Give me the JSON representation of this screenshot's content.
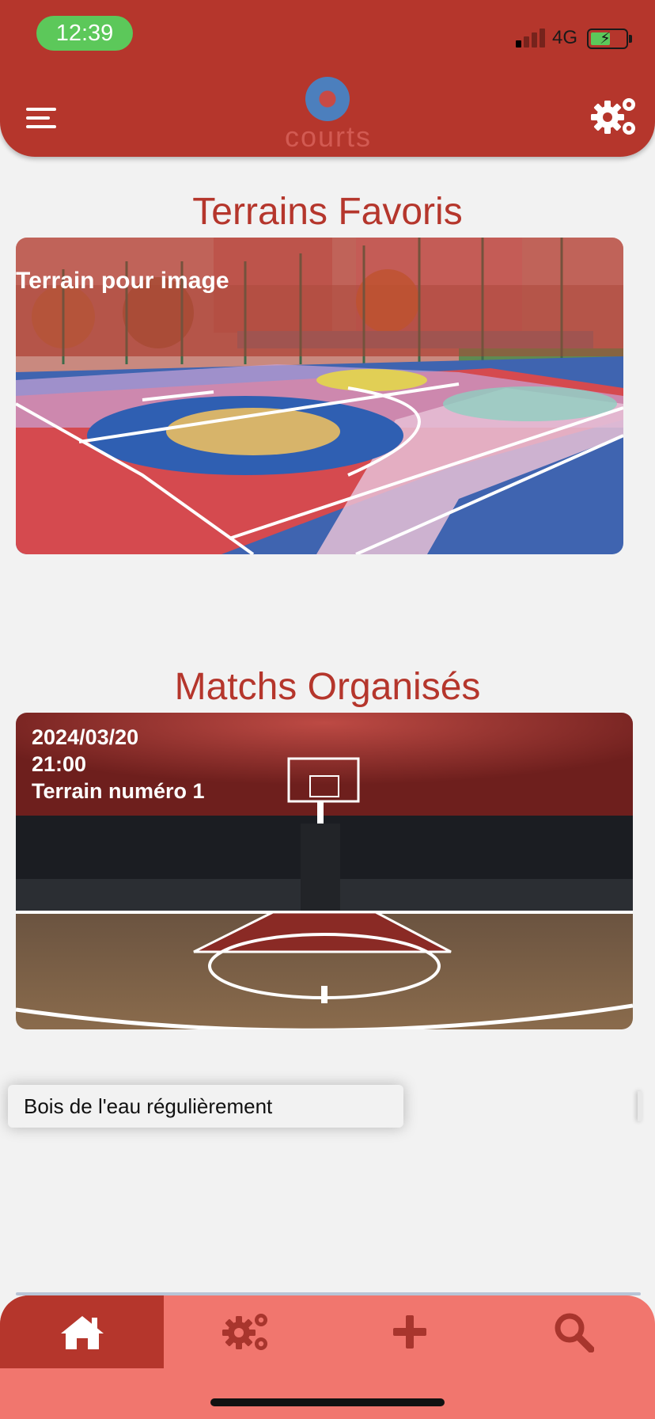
{
  "status_bar": {
    "time": "12:39",
    "network": "4G"
  },
  "header": {
    "logo_text": "courts"
  },
  "favorites": {
    "title": "Terrains Favoris",
    "card": {
      "label": "Terrain pour image"
    }
  },
  "matches": {
    "title": "Matchs Organisés",
    "card": {
      "date": "2024/03/20",
      "time": "21:00",
      "court": "Terrain numéro 1"
    }
  },
  "tip": {
    "text": "Bois de l'eau régulièrement"
  },
  "bottom_nav": {
    "items": [
      {
        "icon": "home-icon",
        "active": true
      },
      {
        "icon": "gears-icon",
        "active": false
      },
      {
        "icon": "plus-icon",
        "active": false
      },
      {
        "icon": "search-icon",
        "active": false
      }
    ]
  },
  "colors": {
    "primary": "#b5362c",
    "nav_bg": "#f1766e",
    "status_green": "#5cc85a",
    "background": "#f2f2f2"
  }
}
